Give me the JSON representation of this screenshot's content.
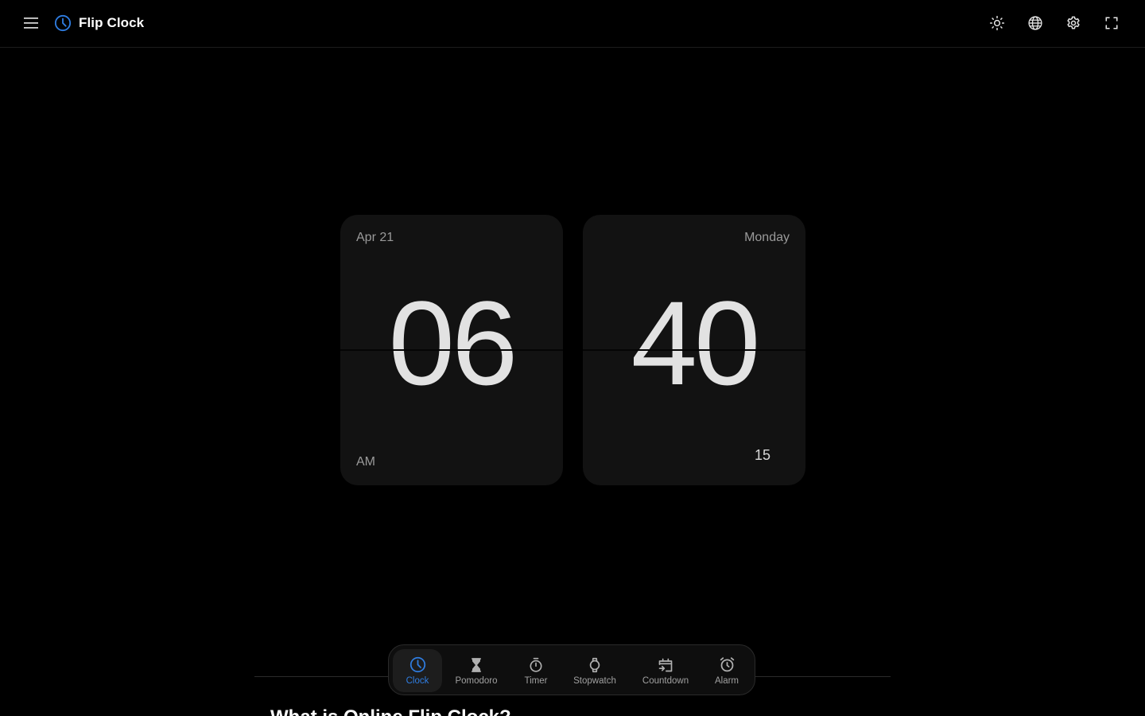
{
  "app": {
    "title": "Flip Clock",
    "accent_color": "#2f7de1"
  },
  "header": {
    "menu_icon": "menu-icon",
    "logo_icon": "clock-icon",
    "actions": [
      {
        "name": "theme-toggle",
        "icon": "sun-icon"
      },
      {
        "name": "language",
        "icon": "globe-icon"
      },
      {
        "name": "settings",
        "icon": "gear-icon"
      },
      {
        "name": "fullscreen",
        "icon": "fullscreen-icon"
      }
    ]
  },
  "clock": {
    "date": "Apr 21",
    "weekday": "Monday",
    "hours": "06",
    "minutes": "40",
    "seconds": "15",
    "meridiem": "AM"
  },
  "dock": {
    "items": [
      {
        "label": "Clock",
        "icon": "clock-icon",
        "active": true
      },
      {
        "label": "Pomodoro",
        "icon": "hourglass-icon",
        "active": false
      },
      {
        "label": "Timer",
        "icon": "timer-icon",
        "active": false
      },
      {
        "label": "Stopwatch",
        "icon": "stopwatch-icon",
        "active": false
      },
      {
        "label": "Countdown",
        "icon": "calendar-arrow-icon",
        "active": false
      },
      {
        "label": "Alarm",
        "icon": "alarm-icon",
        "active": false
      }
    ]
  },
  "article": {
    "heading": "What is Online Flip Clock?"
  }
}
